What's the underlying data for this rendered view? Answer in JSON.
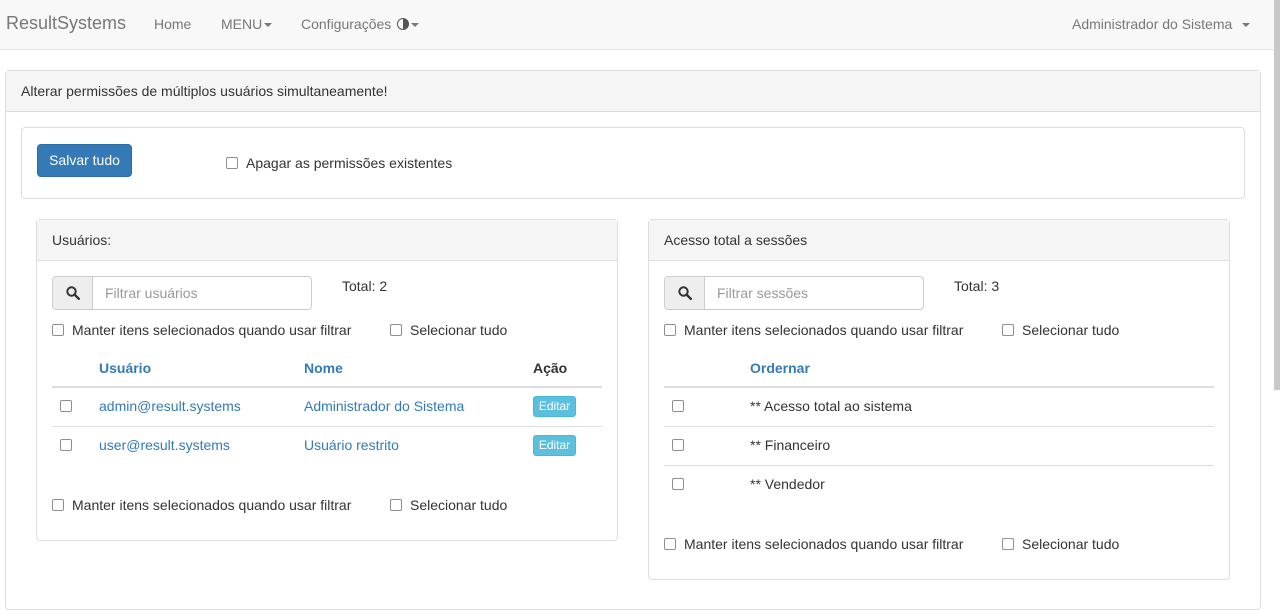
{
  "navbar": {
    "brand": "ResultSystems",
    "home": "Home",
    "menu": "MENU",
    "config": "Configurações",
    "user": "Administrador do Sistema"
  },
  "panel": {
    "title": "Alterar permissões de múltiplos usuários simultaneamente!",
    "save_all": "Salvar tudo",
    "erase_existing": "Apagar as permissões existentes"
  },
  "users": {
    "title": "Usuários:",
    "search_placeholder": "Filtrar usuários",
    "total": "Total: 2",
    "keep_selected": "Manter itens selecionados quando usar filtrar",
    "select_all": "Selecionar tudo",
    "columns": {
      "user": "Usuário",
      "name": "Nome",
      "action": "Ação"
    },
    "rows": [
      {
        "user": "admin@result.systems",
        "name": "Administrador do Sistema",
        "action": "Editar"
      },
      {
        "user": "user@result.systems",
        "name": "Usuário restrito",
        "action": "Editar"
      }
    ]
  },
  "sessions": {
    "title": "Acesso total a sessões",
    "search_placeholder": "Filtrar sessões",
    "total": "Total: 3",
    "keep_selected": "Manter itens selecionados quando usar filtrar",
    "select_all": "Selecionar tudo",
    "columns": {
      "order": "Ordernar"
    },
    "rows": [
      {
        "name": "** Acesso total ao sistema"
      },
      {
        "name": "** Financeiro"
      },
      {
        "name": "** Vendedor"
      }
    ]
  },
  "colors": {
    "primary": "#337ab7",
    "info": "#5bc0de",
    "navbar_bg": "#f8f8f8",
    "panel_head_bg": "#f5f5f5"
  },
  "icons": {
    "search": "search-icon",
    "contrast": "contrast-icon",
    "caret": "caret-down-icon"
  }
}
